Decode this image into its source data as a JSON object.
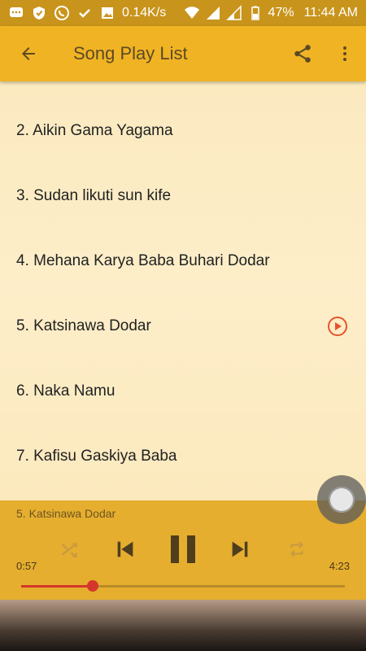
{
  "status_bar": {
    "network_speed": "0.14K/s",
    "battery": "47%",
    "time": "11:44 AM"
  },
  "app_bar": {
    "title": "Song Play List"
  },
  "playlist": [
    {
      "label": "2. Aikin Gama Yagama",
      "playing": false
    },
    {
      "label": "3. Sudan likuti sun kife",
      "playing": false
    },
    {
      "label": "4. Mehana Karya Baba Buhari Dodar",
      "playing": false
    },
    {
      "label": "5. Katsinawa Dodar",
      "playing": true
    },
    {
      "label": "6. Naka Namu",
      "playing": false
    },
    {
      "label": "7. Kafisu Gaskiya Baba",
      "playing": false
    }
  ],
  "player": {
    "now_playing": "5. Katsinawa Dodar",
    "elapsed": "0:57",
    "duration": "4:23",
    "progress": 0.22
  },
  "colors": {
    "app_bar": "#f0b323",
    "status_bar": "#c8941b",
    "player": "#e5ae2e",
    "accent": "#d4362c",
    "play_icon": "#e8532a"
  }
}
